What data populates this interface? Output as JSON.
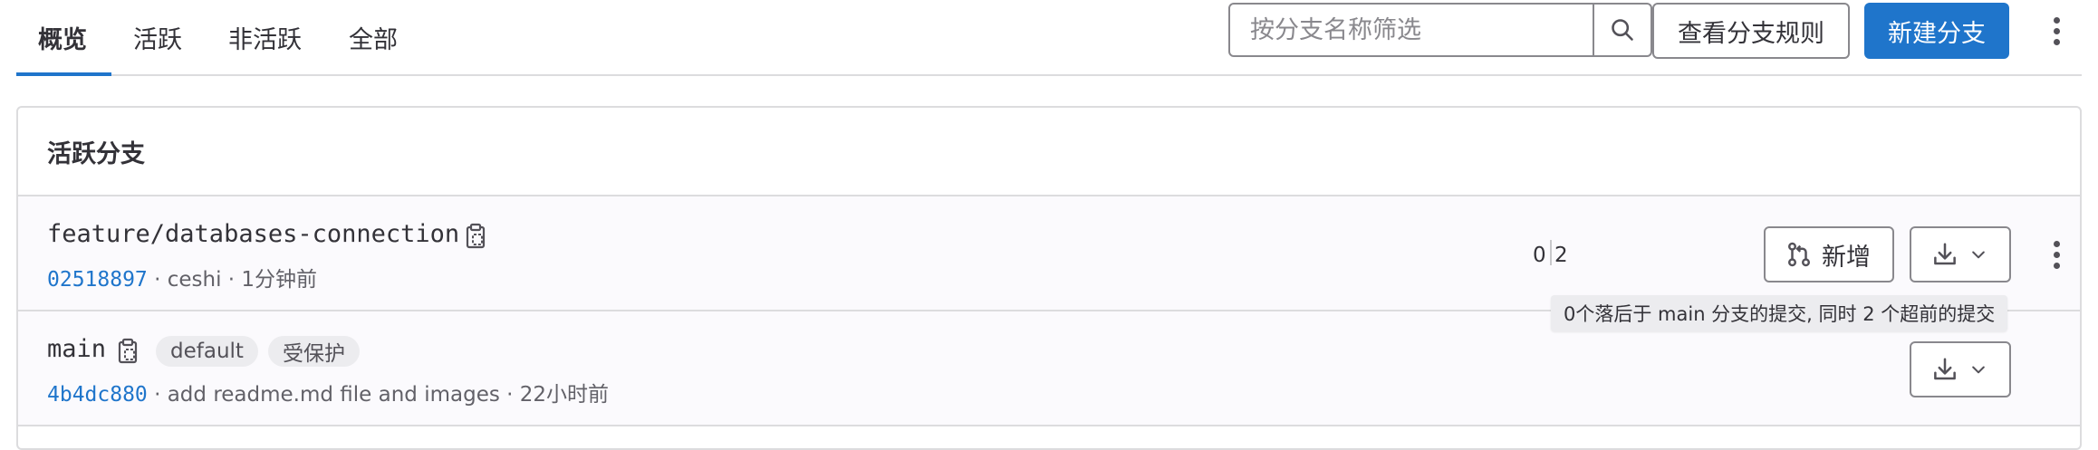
{
  "tabs": [
    {
      "label": "概览",
      "active": true
    },
    {
      "label": "活跃"
    },
    {
      "label": "非活跃"
    },
    {
      "label": "全部"
    }
  ],
  "search": {
    "placeholder": "按分支名称筛选",
    "icon": "search-icon"
  },
  "actions": {
    "view_rules_label": "查看分支规则",
    "new_branch_label": "新建分支"
  },
  "section": {
    "title": "活跃分支"
  },
  "branches": [
    {
      "name": "feature/databases-connection",
      "sha": "02518897",
      "meta_rest": " · ceshi · 1分钟前",
      "behind": "0",
      "ahead": "2",
      "new_mr_label": "新增"
    },
    {
      "name": "main",
      "sha": "4b4dc880",
      "meta_rest": " · add readme.md file and images · 22小时前",
      "badges": [
        "default",
        "受保护"
      ]
    }
  ],
  "tooltip": {
    "text": "0个落后于 main 分支的提交, 同时 2 个超前的提交"
  },
  "colors": {
    "accent": "#1f75cb",
    "border": "#dcdcde",
    "row_bg": "#fbfafd",
    "text": "#333238",
    "muted": "#626168",
    "badge_bg": "#ececef"
  }
}
